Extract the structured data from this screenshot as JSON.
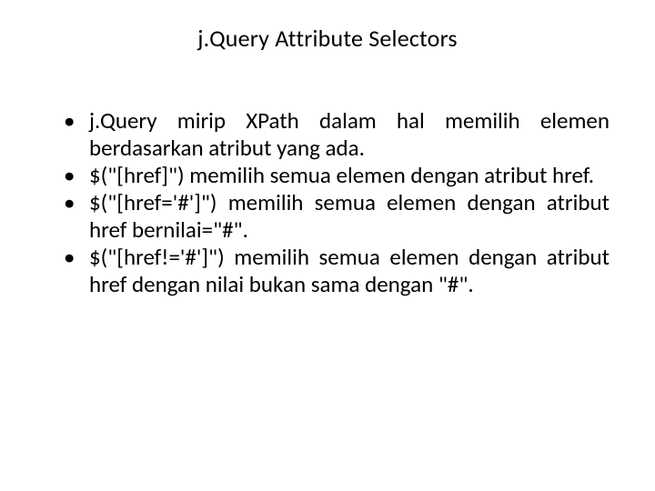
{
  "slide": {
    "title": "j.Query Attribute Selectors",
    "bullets": [
      "j.Query mirip XPath dalam hal memilih elemen berdasarkan atribut yang ada.",
      "$(\"[href]\") memilih semua elemen dengan atribut href.",
      "$(\"[href='#']\") memilih semua elemen dengan atribut href bernilai=\"#\".",
      "$(\"[href!='#']\") memilih semua elemen dengan atribut href dengan nilai bukan sama dengan \"#\"."
    ]
  }
}
